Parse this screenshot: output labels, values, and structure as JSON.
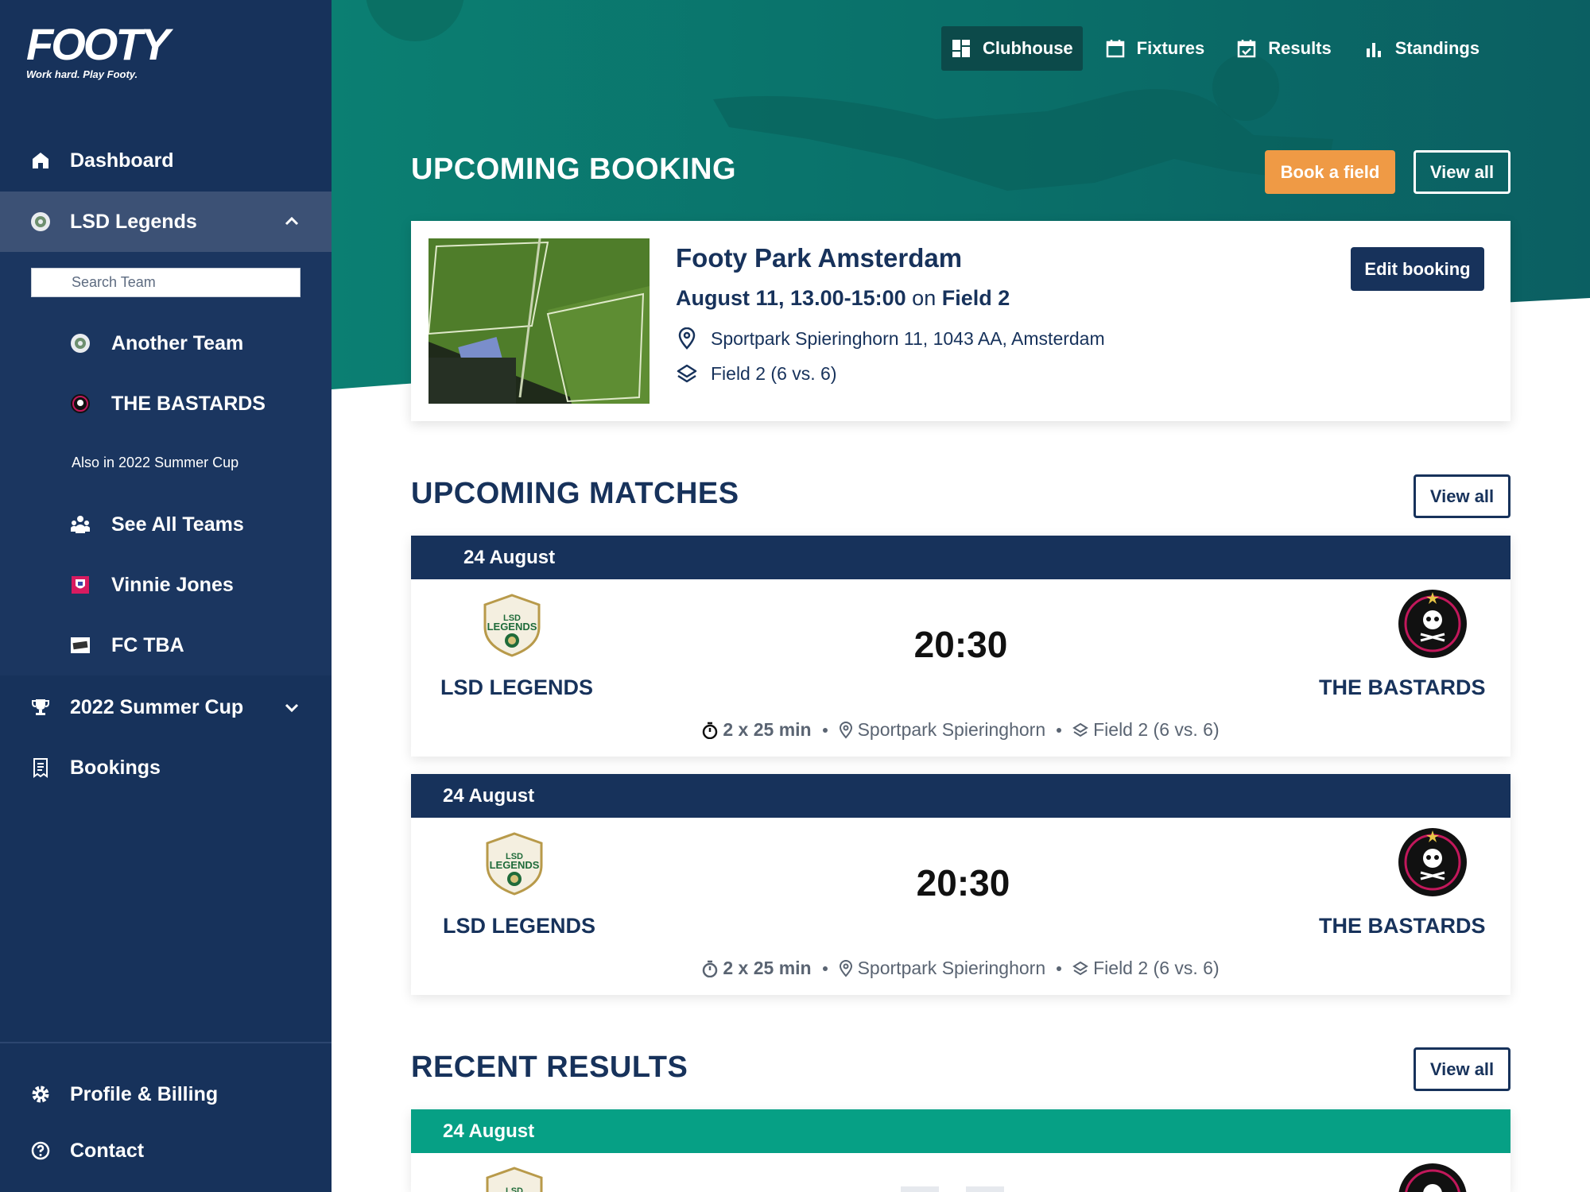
{
  "brand": {
    "name": "FOOTY",
    "tagline": "Work hard. Play Footy."
  },
  "colors": {
    "sidebar": "#17325b",
    "accent_teal": "#06a085",
    "accent_orange": "#ef9a45",
    "hero_teal": "#0b6a64"
  },
  "sidebar": {
    "dashboard": "Dashboard",
    "team_selected": "LSD Legends",
    "search_placeholder": "Search Team",
    "teams": [
      "Another Team",
      "THE BASTARDS"
    ],
    "also_in": "Also in 2022 Summer Cup",
    "cup_items": [
      "See All Teams",
      "Vinnie Jones",
      "FC TBA"
    ],
    "competition": "2022 Summer Cup",
    "bookings": "Bookings",
    "profile": "Profile & Billing",
    "contact": "Contact"
  },
  "topnav": [
    "Clubhouse",
    "Fixtures",
    "Results",
    "Standings"
  ],
  "booking_section": {
    "title": "UPCOMING BOOKING",
    "book_button": "Book a field",
    "view_all": "View all",
    "venue": "Footy Park Amsterdam",
    "date_time": "August 11, 13.00-15:00",
    "on": "on",
    "field": "Field 2",
    "address": "Sportpark Spieringhorn 11, 1043 AA, Amsterdam",
    "field_detail": "Field 2 (6 vs. 6)",
    "edit_button": "Edit booking"
  },
  "matches_section": {
    "title": "UPCOMING MATCHES",
    "view_all": "View all",
    "matches": [
      {
        "date": "24 August",
        "home": "LSD LEGENDS",
        "away": "THE BASTARDS",
        "time": "20:30",
        "duration": "2 x 25 min",
        "venue": "Sportpark Spieringhorn",
        "field": "Field 2 (6 vs. 6)"
      },
      {
        "date": "24 August",
        "home": "LSD LEGENDS",
        "away": "THE BASTARDS",
        "time": "20:30",
        "duration": "2 x 25 min",
        "venue": "Sportpark Spieringhorn",
        "field": "Field 2 (6 vs. 6)"
      }
    ]
  },
  "results_section": {
    "title": "RECENT RESULTS",
    "view_all": "View all",
    "results": [
      {
        "date": "24 August"
      }
    ]
  }
}
